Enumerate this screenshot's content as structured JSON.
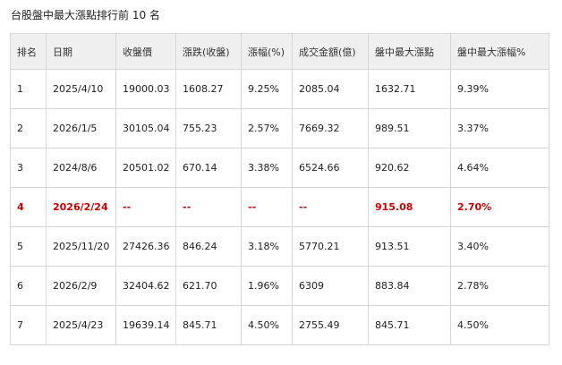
{
  "caption": "台股盤中最大漲點排行前 10 名",
  "table": {
    "headers": [
      "排名",
      "日期",
      "收盤價",
      "漲跌(收盤)",
      "漲幅(%)",
      "成交金額(億)",
      "盤中最大漲點",
      "盤中最大漲幅%"
    ],
    "rows": [
      {
        "rank": "1",
        "date": "2025/4/10",
        "close": "19000.03",
        "change": "1608.27",
        "pct": "9.25%",
        "turnover": "2085.04",
        "max_points": "1632.71",
        "max_pct": "9.39%",
        "highlight": false
      },
      {
        "rank": "2",
        "date": "2026/1/5",
        "close": "30105.04",
        "change": "755.23",
        "pct": "2.57%",
        "turnover": "7669.32",
        "max_points": "989.51",
        "max_pct": "3.37%",
        "highlight": false
      },
      {
        "rank": "3",
        "date": "2024/8/6",
        "close": "20501.02",
        "change": "670.14",
        "pct": "3.38%",
        "turnover": "6524.66",
        "max_points": "920.62",
        "max_pct": "4.64%",
        "highlight": false
      },
      {
        "rank": "4",
        "date": "2026/2/24",
        "close": "--",
        "change": "--",
        "pct": "--",
        "turnover": "--",
        "max_points": "915.08",
        "max_pct": "2.70%",
        "highlight": true
      },
      {
        "rank": "5",
        "date": "2025/11/20",
        "close": "27426.36",
        "change": "846.24",
        "pct": "3.18%",
        "turnover": "5770.21",
        "max_points": "913.51",
        "max_pct": "3.40%",
        "highlight": false
      },
      {
        "rank": "6",
        "date": "2026/2/9",
        "close": "32404.62",
        "change": "621.70",
        "pct": "1.96%",
        "turnover": "6309",
        "max_points": "883.84",
        "max_pct": "2.78%",
        "highlight": false
      },
      {
        "rank": "7",
        "date": "2025/4/23",
        "close": "19639.14",
        "change": "845.71",
        "pct": "4.50%",
        "turnover": "2755.49",
        "max_points": "845.71",
        "max_pct": "4.50%",
        "highlight": false
      }
    ]
  },
  "colors": {
    "highlight_text": "#cc0000",
    "header_background": "#f0f0f0",
    "border": "#d6d6d6"
  }
}
